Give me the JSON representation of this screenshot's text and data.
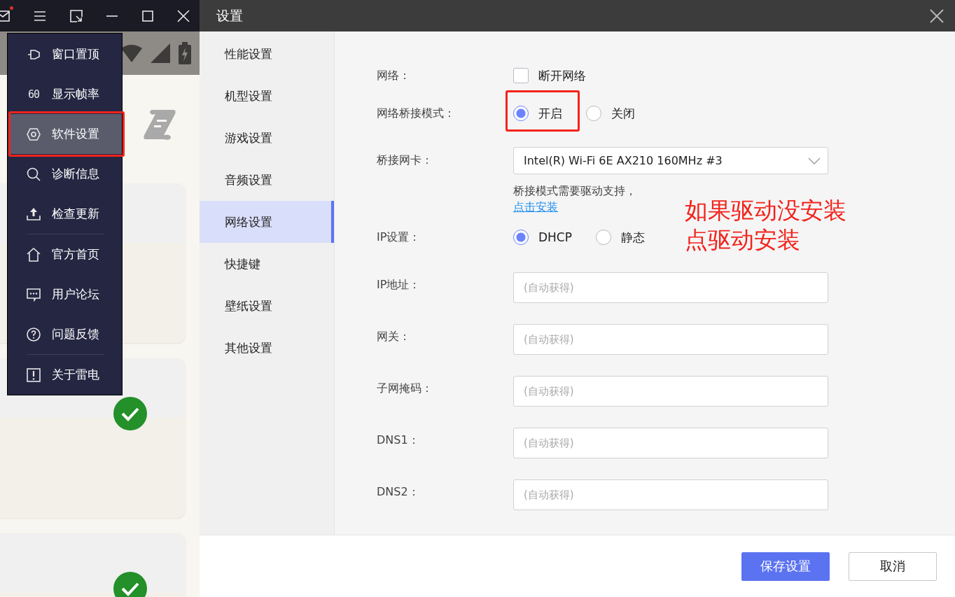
{
  "app": {
    "notification_dot": true,
    "menu": {
      "items": [
        {
          "label": "窗口置顶",
          "selected": false,
          "highlighted": false,
          "divider_after": false
        },
        {
          "label": "显示帧率",
          "icon_text": "60",
          "selected": false,
          "highlighted": false,
          "divider_after": false
        },
        {
          "label": "软件设置",
          "selected": true,
          "highlighted": true,
          "divider_after": false
        },
        {
          "label": "诊断信息",
          "selected": false,
          "highlighted": false,
          "divider_after": false
        },
        {
          "label": "检查更新",
          "selected": false,
          "highlighted": false,
          "divider_after": true
        },
        {
          "label": "官方首页",
          "selected": false,
          "highlighted": false,
          "divider_after": false
        },
        {
          "label": "用户论坛",
          "selected": false,
          "highlighted": false,
          "divider_after": false
        },
        {
          "label": "问题反馈",
          "selected": false,
          "highlighted": false,
          "divider_after": true
        },
        {
          "label": "关于雷电",
          "selected": false,
          "highlighted": false,
          "divider_after": false
        }
      ]
    }
  },
  "dialog": {
    "title": "设置",
    "nav": [
      {
        "label": "性能设置",
        "selected": false
      },
      {
        "label": "机型设置",
        "selected": false
      },
      {
        "label": "游戏设置",
        "selected": false
      },
      {
        "label": "音频设置",
        "selected": false
      },
      {
        "label": "网络设置",
        "selected": true
      },
      {
        "label": "快捷键",
        "selected": false
      },
      {
        "label": "壁纸设置",
        "selected": false
      },
      {
        "label": "其他设置",
        "selected": false
      }
    ],
    "form": [
      {
        "kind": "checkbox",
        "label": "网络：",
        "options": [
          {
            "label": "断开网络",
            "checked": false
          }
        ]
      },
      {
        "kind": "radio",
        "label": "网络桥接模式：",
        "options": [
          {
            "label": "开启",
            "selected": true,
            "highlighted": true
          },
          {
            "label": "关闭",
            "selected": false
          }
        ]
      },
      {
        "kind": "select",
        "label": "桥接网卡：",
        "value": "Intel(R) Wi-Fi 6E AX210 160MHz #3"
      },
      {
        "kind": "note",
        "text": "桥接模式需要驱动支持，",
        "link": "点击安装"
      },
      {
        "kind": "radio",
        "label": "IP设置：",
        "options": [
          {
            "label": "DHCP",
            "selected": true
          },
          {
            "label": "静态",
            "selected": false
          }
        ]
      },
      {
        "kind": "input",
        "label": "IP地址：",
        "placeholder": "(自动获得)"
      },
      {
        "kind": "input",
        "label": "网关：",
        "placeholder": "(自动获得)"
      },
      {
        "kind": "input",
        "label": "子网掩码：",
        "placeholder": "(自动获得)"
      },
      {
        "kind": "input",
        "label": "DNS1：",
        "placeholder": "(自动获得)"
      },
      {
        "kind": "input",
        "label": "DNS2：",
        "placeholder": "(自动获得)"
      }
    ],
    "buttons": [
      {
        "label": "保存设置",
        "kind": "primary"
      },
      {
        "label": "取消",
        "kind": "default"
      }
    ]
  },
  "annotation": {
    "lines": [
      "如果驱动没安装",
      "点驱动安装"
    ]
  }
}
